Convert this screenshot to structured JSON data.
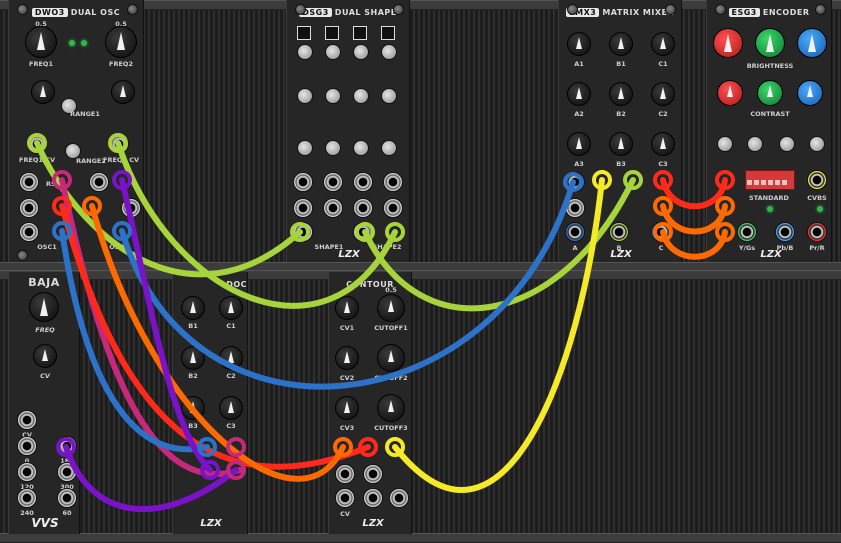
{
  "colors": {
    "lime": "#a6d43a",
    "magenta": "#c8287a",
    "red": "#ff2a1a",
    "orange": "#ff6a00",
    "blue": "#2d72c9",
    "purple": "#7a12c8",
    "yellow": "#f5ea28",
    "teal": "#2d7a99"
  },
  "modules": {
    "dwo3": {
      "tag": "DWO3",
      "name": "DUAL OSC",
      "labels": [
        "FREQ1",
        "FREQ2",
        "RANGE1",
        "RANGE2",
        "FREQ1 CV",
        "FREQ2 CV",
        "RST",
        "OSC1",
        "OSC2",
        "0.5",
        "0.5"
      ]
    },
    "dsg3": {
      "tag": "DSG3",
      "name": "DUAL SHAPE",
      "labels": [
        "SHAPE1",
        "SHAPE2"
      ]
    },
    "smx3": {
      "tag": "SMX3",
      "name": "MATRIX MIXER",
      "knob_labels": [
        "A1",
        "B1",
        "C1",
        "A2",
        "B2",
        "C2",
        "A3",
        "B3",
        "C3"
      ],
      "jack_labels": [
        "A",
        "B",
        "C"
      ]
    },
    "esg3": {
      "tag": "ESG3",
      "name": "ENCODER",
      "labels": [
        "BRIGHTNESS",
        "CONTRAST",
        "STANDARD",
        "CVBS",
        "Y/Gs",
        "Pb/B",
        "Pr/R"
      ]
    },
    "baja": {
      "name": "BAJA",
      "labels": [
        "FREQ",
        "CV",
        "CV",
        "0",
        "120",
        "240",
        "180",
        "300",
        "60"
      ],
      "logo": "VVS"
    },
    "doc": {
      "name": "DOC",
      "labels": [
        "B1",
        "C1",
        "B2",
        "C2",
        "B3",
        "C3"
      ]
    },
    "contour": {
      "name": "CONTOUR",
      "labels": [
        "CV1",
        "CUTOFF1",
        "CV2",
        "CUTOFF2",
        "CV3",
        "CUTOFF3",
        "CV",
        "0.5"
      ]
    },
    "brand": "LZX"
  }
}
